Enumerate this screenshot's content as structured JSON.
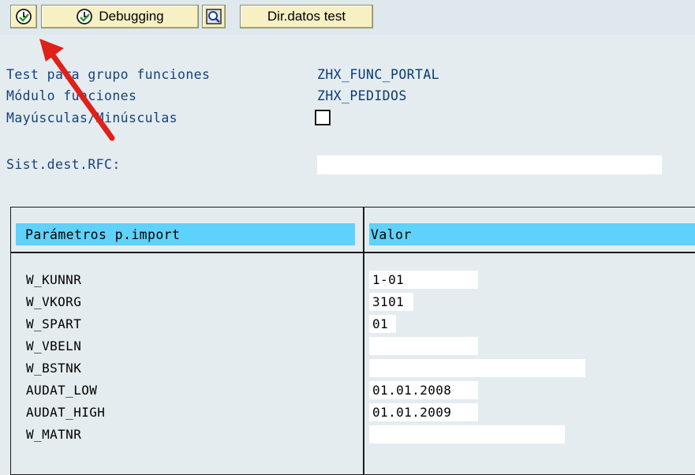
{
  "toolbar": {
    "execute_icon": "clock-check-icon",
    "debugging_label": "Debugging",
    "debugging_icon": "clock-check-icon",
    "test_data_icon": "magnifier-icon",
    "test_data_label": "Dir.datos test"
  },
  "header": {
    "group_label": "Test para grupo funciones",
    "group_value": "ZHX_FUNC_PORTAL",
    "module_label": "Módulo funciones",
    "module_value": "ZHX_PEDIDOS",
    "case_label": "Mayúsculas/Minúsculas",
    "case_checked": false,
    "rfc_label": "Sist.dest.RFC:",
    "rfc_value": ""
  },
  "params_table": {
    "columns": [
      "Parámetros p.import",
      "Valor"
    ],
    "rows": [
      {
        "name": "W_KUNNR",
        "value": "1-01"
      },
      {
        "name": "W_VKORG",
        "value": "3101"
      },
      {
        "name": "W_SPART",
        "value": "01"
      },
      {
        "name": "W_VBELN",
        "value": ""
      },
      {
        "name": "W_BSTNK",
        "value": ""
      },
      {
        "name": "AUDAT_LOW",
        "value": "01.01.2008"
      },
      {
        "name": "AUDAT_HIGH",
        "value": "01.01.2009"
      },
      {
        "name": "W_MATNR",
        "value": ""
      }
    ]
  },
  "colors": {
    "highlight_arrow": "#e0201a",
    "column_header": "#5ed2fa",
    "button_bg": "#f6f0c4"
  }
}
